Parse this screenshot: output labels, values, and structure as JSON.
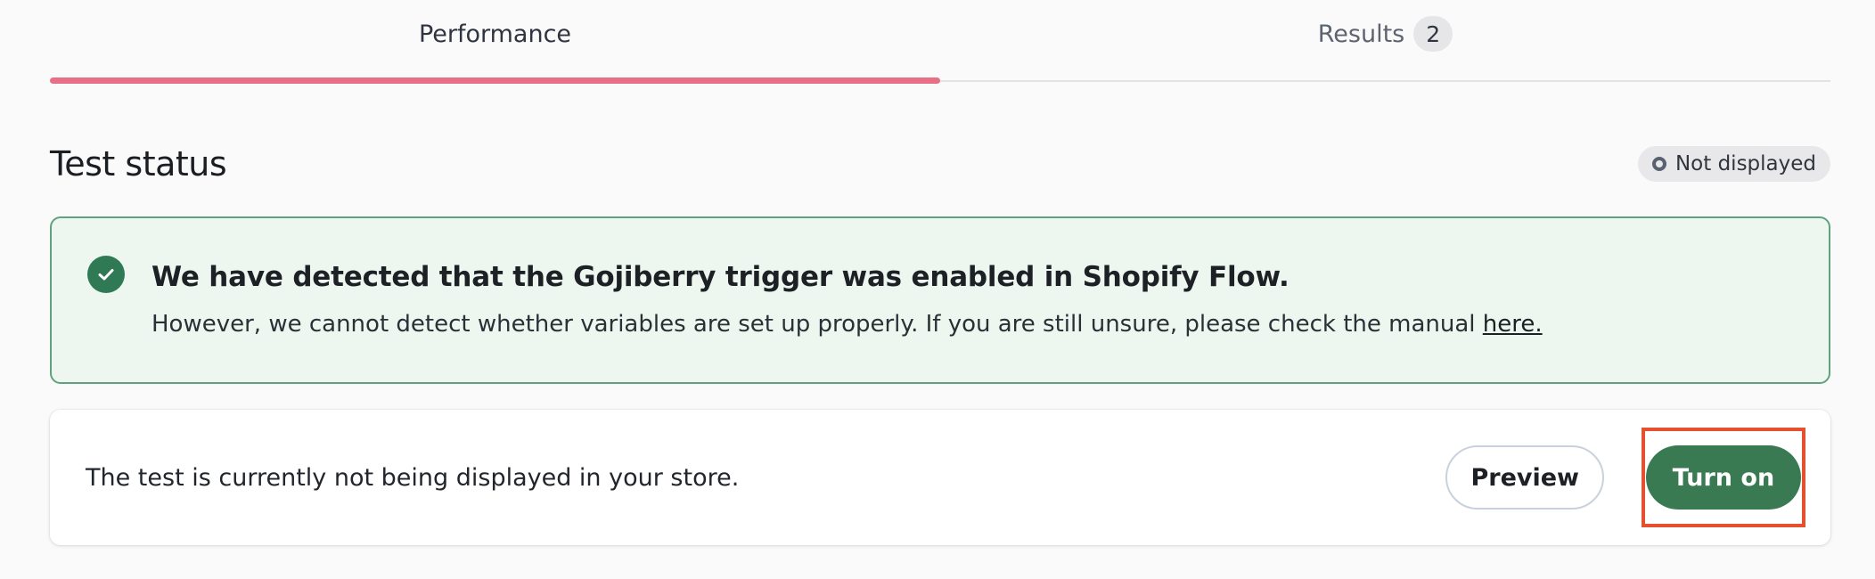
{
  "tabs": [
    {
      "label": "Performance",
      "active": true
    },
    {
      "label": "Results",
      "badge": "2",
      "active": false
    }
  ],
  "status": {
    "title": "Test status",
    "pill_label": "Not displayed"
  },
  "banner": {
    "icon": "check-circle-icon",
    "title": "We have detected that the Gojiberry trigger was enabled in Shopify Flow.",
    "body": "However, we cannot detect whether variables are set up properly. If you are still unsure, please check the manual ",
    "link_label": "here.",
    "colors": {
      "background": "#edf7ef",
      "border": "#5fa27d",
      "icon": "#2f7a55"
    }
  },
  "card": {
    "message": "The test is currently not being displayed in your store.",
    "preview_label": "Preview",
    "turn_on_label": "Turn on"
  },
  "colors": {
    "active_tab_underline": "#e86f86",
    "primary_button": "#3a7a53",
    "highlight_box": "#e5502f"
  }
}
